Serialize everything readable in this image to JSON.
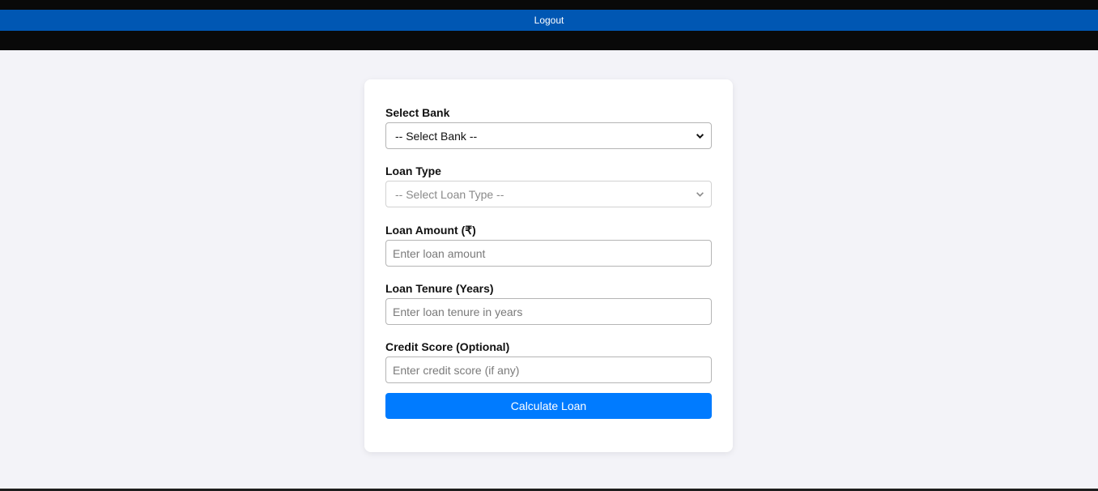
{
  "header": {
    "logout_label": "Logout"
  },
  "form": {
    "bank": {
      "label": "Select Bank",
      "selected": "-- Select Bank --"
    },
    "loan_type": {
      "label": "Loan Type",
      "selected": "-- Select Loan Type --",
      "disabled": true
    },
    "loan_amount": {
      "label": "Loan Amount (₹)",
      "placeholder": "Enter loan amount",
      "value": ""
    },
    "loan_tenure": {
      "label": "Loan Tenure (Years)",
      "placeholder": "Enter loan tenure in years",
      "value": ""
    },
    "credit_score": {
      "label": "Credit Score (Optional)",
      "placeholder": "Enter credit score (if any)",
      "value": ""
    },
    "submit_label": "Calculate Loan"
  },
  "colors": {
    "header_bg": "#090909",
    "logout_bar": "#0057b3",
    "button": "#007bff",
    "page_bg": "#f3f3f8"
  },
  "icons": {
    "select_arrow": "chevron-down-icon"
  }
}
